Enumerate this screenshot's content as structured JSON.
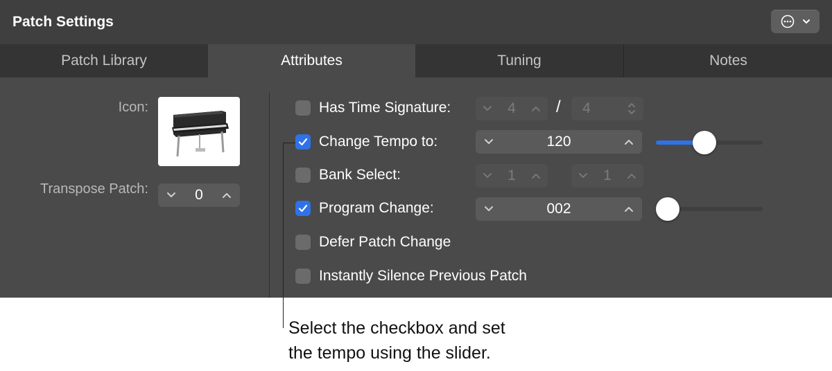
{
  "window": {
    "title": "Patch Settings",
    "menu_button_icons": [
      "ellipsis-circle-icon",
      "chevron-down-icon"
    ]
  },
  "tabs": [
    {
      "label": "Patch Library",
      "active": false
    },
    {
      "label": "Attributes",
      "active": true
    },
    {
      "label": "Tuning",
      "active": false
    },
    {
      "label": "Notes",
      "active": false
    }
  ],
  "left": {
    "icon_label": "Icon:",
    "icon_image": "electric-piano-icon",
    "transpose_label": "Transpose Patch:",
    "transpose_value": "0"
  },
  "options": {
    "time_signature": {
      "label": "Has Time Signature:",
      "checked": false,
      "numerator": "4",
      "slash": "/",
      "denominator": "4"
    },
    "change_tempo": {
      "label": "Change Tempo to:",
      "checked": true,
      "value": "120",
      "slider_level": 0.44
    },
    "bank_select": {
      "label": "Bank Select:",
      "checked": false,
      "msb": "1",
      "lsb": "1"
    },
    "program_change": {
      "label": "Program Change:",
      "checked": true,
      "value": "002",
      "slider_level": 0.0
    },
    "defer_patch_change": {
      "label": "Defer Patch Change",
      "checked": false
    },
    "instantly_silence": {
      "label": "Instantly Silence Previous Patch",
      "checked": false
    }
  },
  "callout": {
    "line1": "Select the checkbox and set",
    "line2": "the tempo using the slider."
  },
  "colors": {
    "accent": "#2f72e8",
    "panel": "#4a4a4a",
    "titlebar": "#3f3f3f"
  }
}
